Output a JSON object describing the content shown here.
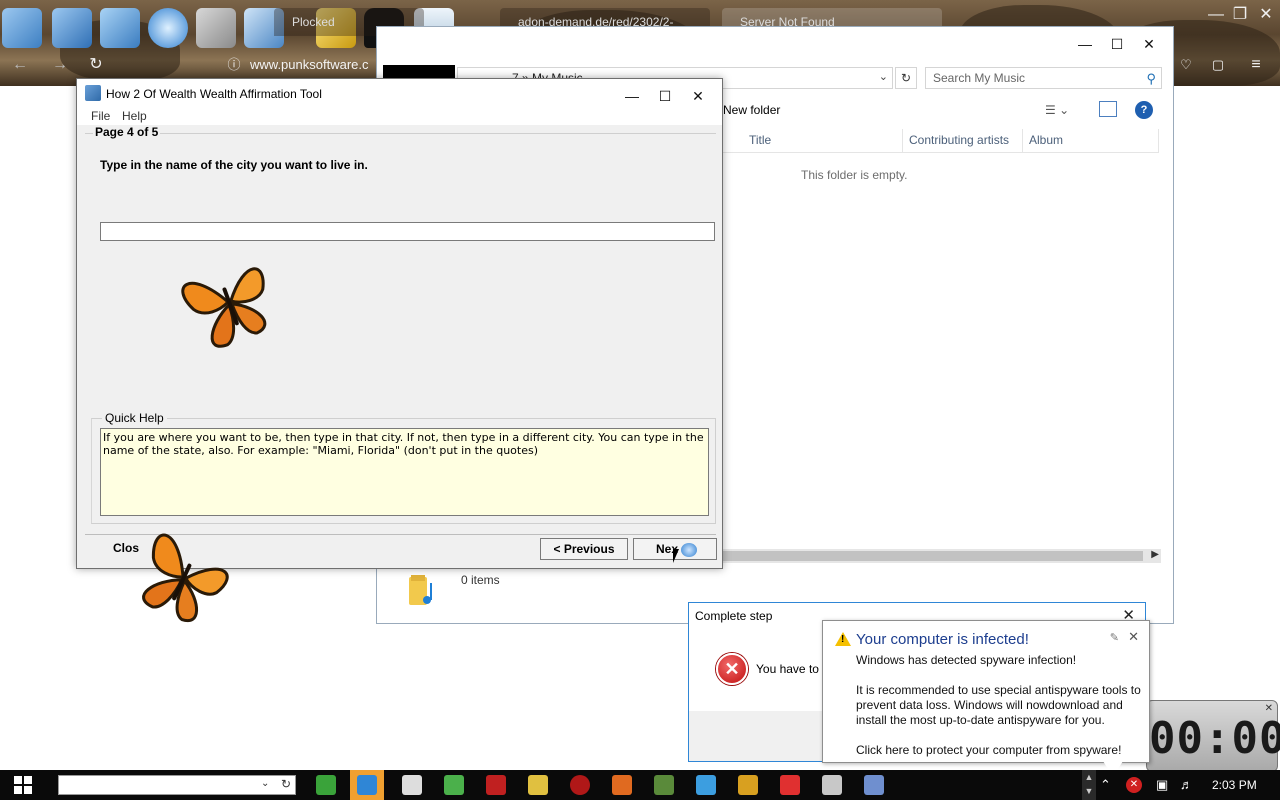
{
  "browser": {
    "tabs": [
      {
        "label": "Plocked"
      },
      {
        "label": "adon-demand.de/red/2302/2-"
      },
      {
        "label": "Server Not Found"
      }
    ],
    "url": "www.punksoftware.c"
  },
  "explorer": {
    "address": "7 »  My Music",
    "search_placeholder": "Search My Music",
    "new_folder": "New folder",
    "columns": [
      "Title",
      "Contributing artists",
      "Album"
    ],
    "empty_text": "This folder is empty.",
    "status_count": "0 items"
  },
  "wealth": {
    "title": "How 2 Of Wealth Wealth Affirmation Tool",
    "menu": [
      "File",
      "Help"
    ],
    "page_label": "Page 4 of 5",
    "question": "Type in the name of the city you want to live in.",
    "city_value": "",
    "quick_help_label": "Quick Help",
    "quick_help_text": "If you are where you want to be, then type in that city. If not, then type in a different city. You can type in the name of the state, also. For example: \"Miami, Florida\" (don't put in the quotes)",
    "close_label": "Clos",
    "previous_label": "< Previous",
    "next_label": "Nex"
  },
  "complete_step": {
    "title": "Complete step",
    "message": "You have to"
  },
  "balloon": {
    "title": "Your computer is infected!",
    "line1": "Windows has detected spyware infection!",
    "line2": "It is recommended to use special antispyware tools to prevent data loss. Windows will nowdownload and install the most up-to-date antispyware for you.",
    "line3": "Click here to protect your computer from spyware!"
  },
  "clock": {
    "digits": "00:00"
  },
  "taskbar": {
    "time": "2:03 PM"
  },
  "colors": {
    "balloon_title": "#1d3e8f",
    "quick_help_bg": "#ffffe1",
    "active_task": "#f0a030"
  }
}
